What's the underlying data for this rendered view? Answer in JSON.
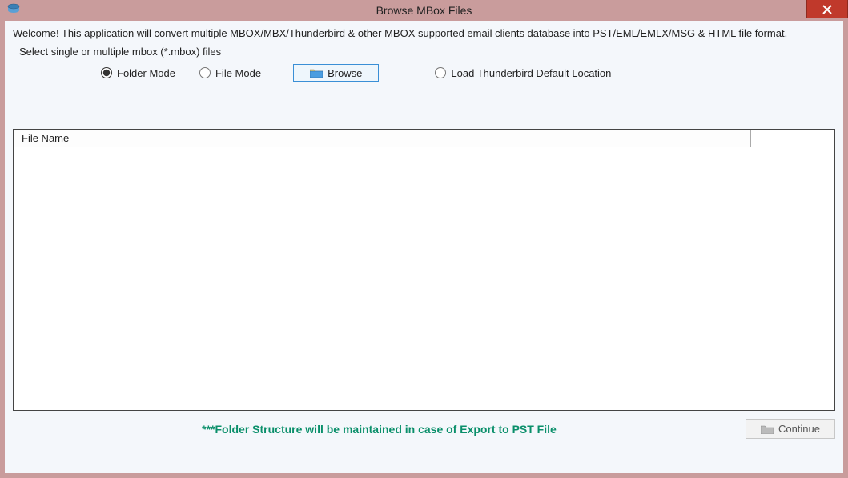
{
  "titlebar": {
    "title": "Browse MBox Files",
    "close_label": "×"
  },
  "welcome": "Welcome! This application will convert multiple MBOX/MBX/Thunderbird & other MBOX supported email clients database into PST/EML/EMLX/MSG & HTML file format.",
  "select_label": "Select single or multiple mbox (*.mbox) files",
  "options": {
    "folder_mode": "Folder Mode",
    "file_mode": "File Mode",
    "browse": "Browse",
    "load_thunderbird": "Load Thunderbird Default Location",
    "selected": "folder_mode"
  },
  "file_list": {
    "header": "File Name",
    "rows": []
  },
  "footer": {
    "note": "***Folder Structure will be maintained in case of Export to PST File",
    "continue": "Continue"
  }
}
